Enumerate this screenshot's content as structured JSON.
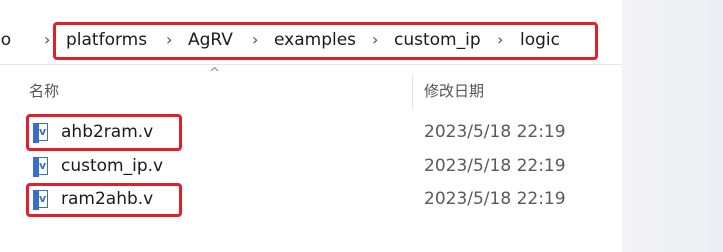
{
  "breadcrumb": {
    "items": [
      "io",
      "platforms",
      "AgRV",
      "examples",
      "custom_ip",
      "logic"
    ]
  },
  "columns": {
    "name": "名称",
    "modified": "修改日期"
  },
  "files": [
    {
      "name": "ahb2ram.v",
      "date": "2023/5/18 22:19",
      "icon_label": "v",
      "highlighted": true
    },
    {
      "name": "custom_ip.v",
      "date": "2023/5/18 22:19",
      "icon_label": "v",
      "highlighted": false
    },
    {
      "name": "ram2ahb.v",
      "date": "2023/5/18 22:19",
      "icon_label": "v",
      "highlighted": true
    }
  ],
  "colors": {
    "highlight": "#e0202a",
    "icon": "#3b6fc6"
  }
}
